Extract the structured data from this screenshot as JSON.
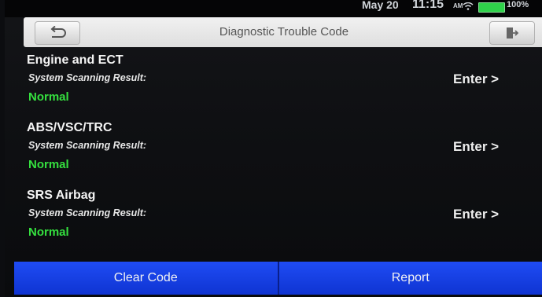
{
  "status": {
    "date": "May 20",
    "time": "11:15",
    "ampm": "AM",
    "battery": "100%"
  },
  "header": {
    "title": "Diagnostic Trouble Code",
    "back_icon": "back-arrow-icon",
    "exit_icon": "exit-icon"
  },
  "systems": [
    {
      "name": "Engine and ECT",
      "scan_label": "System Scanning Result:",
      "result": "Normal",
      "enter": "Enter >"
    },
    {
      "name": "ABS/VSC/TRC",
      "scan_label": "System Scanning Result:",
      "result": "Normal",
      "enter": "Enter >"
    },
    {
      "name": "SRS Airbag",
      "scan_label": "System Scanning Result:",
      "result": "Normal",
      "enter": "Enter >"
    }
  ],
  "buttons": {
    "clear_code": "Clear Code",
    "report": "Report"
  },
  "colors": {
    "result_ok": "#35e03f",
    "button_blue": "#1f4cf4"
  }
}
